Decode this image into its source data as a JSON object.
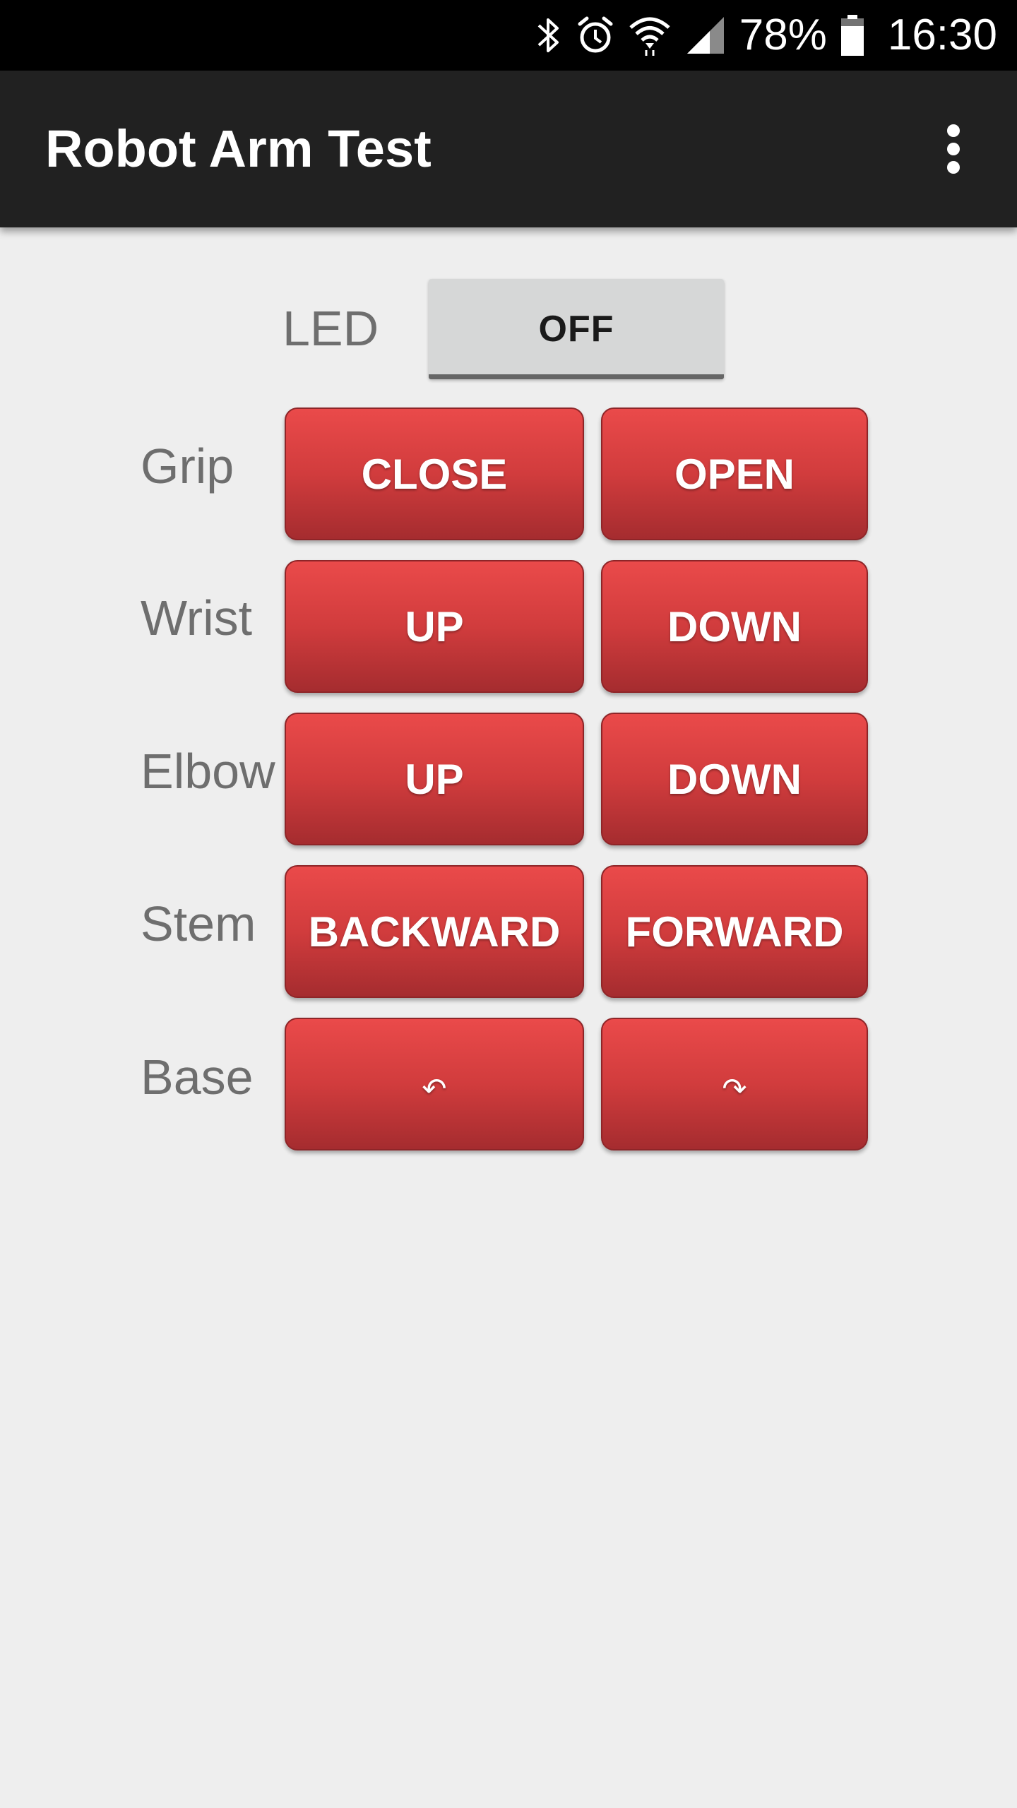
{
  "status_bar": {
    "battery": "78%",
    "time": "16:30",
    "icons": [
      "bluetooth-icon",
      "alarm-icon",
      "wifi-icon",
      "cell-signal-icon",
      "battery-icon"
    ]
  },
  "app_bar": {
    "title": "Robot Arm Test",
    "menu_icon": "more-vert-icon"
  },
  "led": {
    "label": "LED",
    "toggle_text": "OFF"
  },
  "rows": [
    {
      "label": "Grip",
      "left": "CLOSE",
      "right": "OPEN"
    },
    {
      "label": "Wrist",
      "left": "UP",
      "right": "DOWN"
    },
    {
      "label": "Elbow",
      "left": "UP",
      "right": "DOWN"
    },
    {
      "label": "Stem",
      "left": "BACKWARD",
      "right": "FORWARD"
    },
    {
      "label": "Base",
      "left": "↶",
      "right": "↷"
    }
  ],
  "colors": {
    "button_red": "#d13c3d",
    "app_bar": "#212121",
    "background": "#eeeeee"
  }
}
